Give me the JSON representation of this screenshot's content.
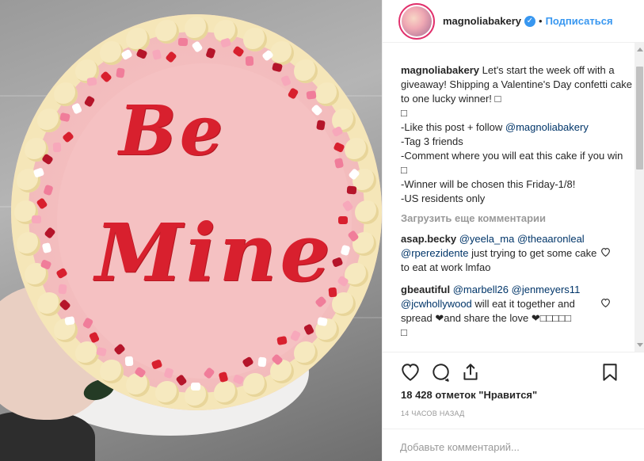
{
  "photo": {
    "script_line1": "Be",
    "script_line2": "Mine",
    "frosting_color": "#f5c1c2",
    "icing_color": "#d8202e"
  },
  "header": {
    "username": "magnoliabakery",
    "verified_icon": "verified-badge-icon",
    "dot": "•",
    "follow_label": "Подписаться"
  },
  "caption": {
    "username": "magnoliabakery",
    "lines": [
      "Let's start the week off with a giveaway! Shipping a Valentine's Day confetti cake to one lucky winner! ",
      "",
      "-Like this post + follow ",
      "-Tag 3 friends",
      "-Comment where you will eat this cake if you win",
      "",
      "-Winner will be chosen this Friday-1/8!",
      "-US residents only"
    ],
    "mention": "@magnoliabakery",
    "emoji_placeholder": "□"
  },
  "load_more": "Загрузить еще комментарии",
  "comments": [
    {
      "username": "asap.becky",
      "mention1": "@yeela_ma",
      "mention2": "@theaaronleal",
      "mention3": "@rperezidente",
      "text": " just trying to get some cake to eat at work lmfao"
    },
    {
      "username": "gbeautiful",
      "mention1": "@marbell26",
      "mention2": "@jenmeyers11",
      "mention3": "@jcwhollywood",
      "text": " will eat it together and spread ❤and share the love ❤□□□□□",
      "tail": "□"
    }
  ],
  "likes": "18 428 отметок \"Нравится\"",
  "timestamp": "14 ЧАСОВ НАЗАД",
  "add_comment_placeholder": "Добавьте комментарий...",
  "icons": {
    "like": "heart-icon",
    "comment": "comment-icon",
    "share": "share-icon",
    "save": "bookmark-icon"
  }
}
